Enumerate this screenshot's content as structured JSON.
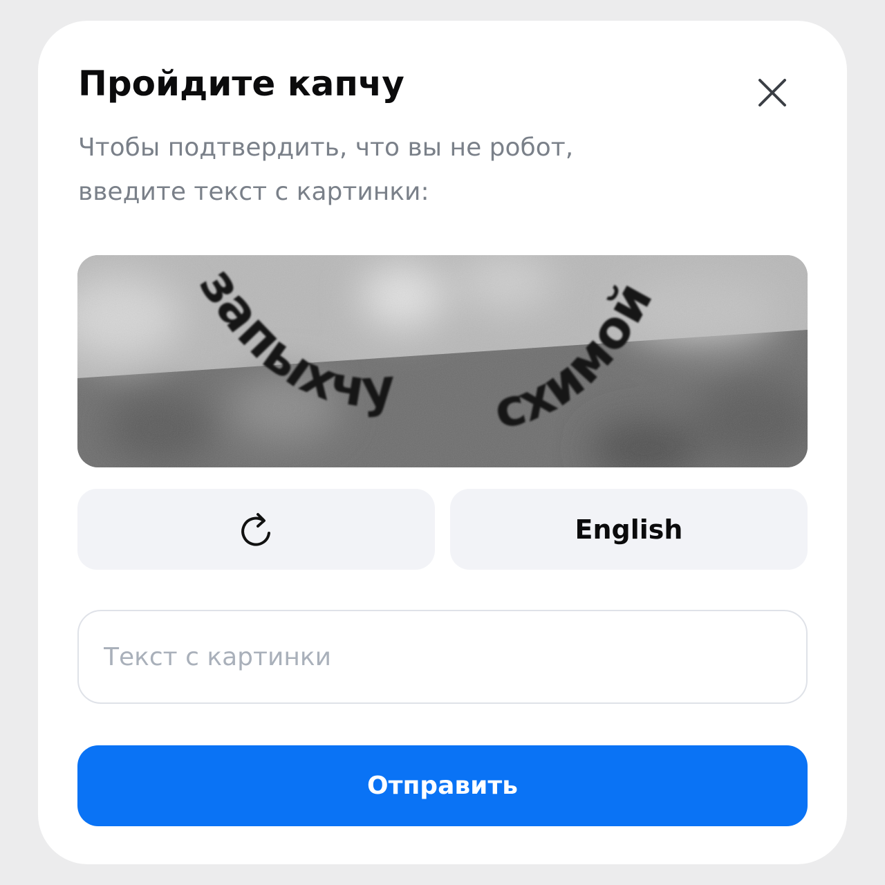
{
  "dialog": {
    "title": "Пройдите капчу",
    "subtitle_line1": "Чтобы подтвердить, что вы не робот,",
    "subtitle_line2": "введите текст с картинки:"
  },
  "captcha": {
    "word1": "запыхчу",
    "word2": "схимой"
  },
  "buttons": {
    "refresh_icon": "refresh-icon",
    "language_label": "English",
    "submit_label": "Отправить"
  },
  "input": {
    "placeholder": "Текст с картинки",
    "value": ""
  },
  "colors": {
    "accent": "#0a73f5",
    "button_bg": "#f2f3f7",
    "subtitle": "#7a8089"
  }
}
